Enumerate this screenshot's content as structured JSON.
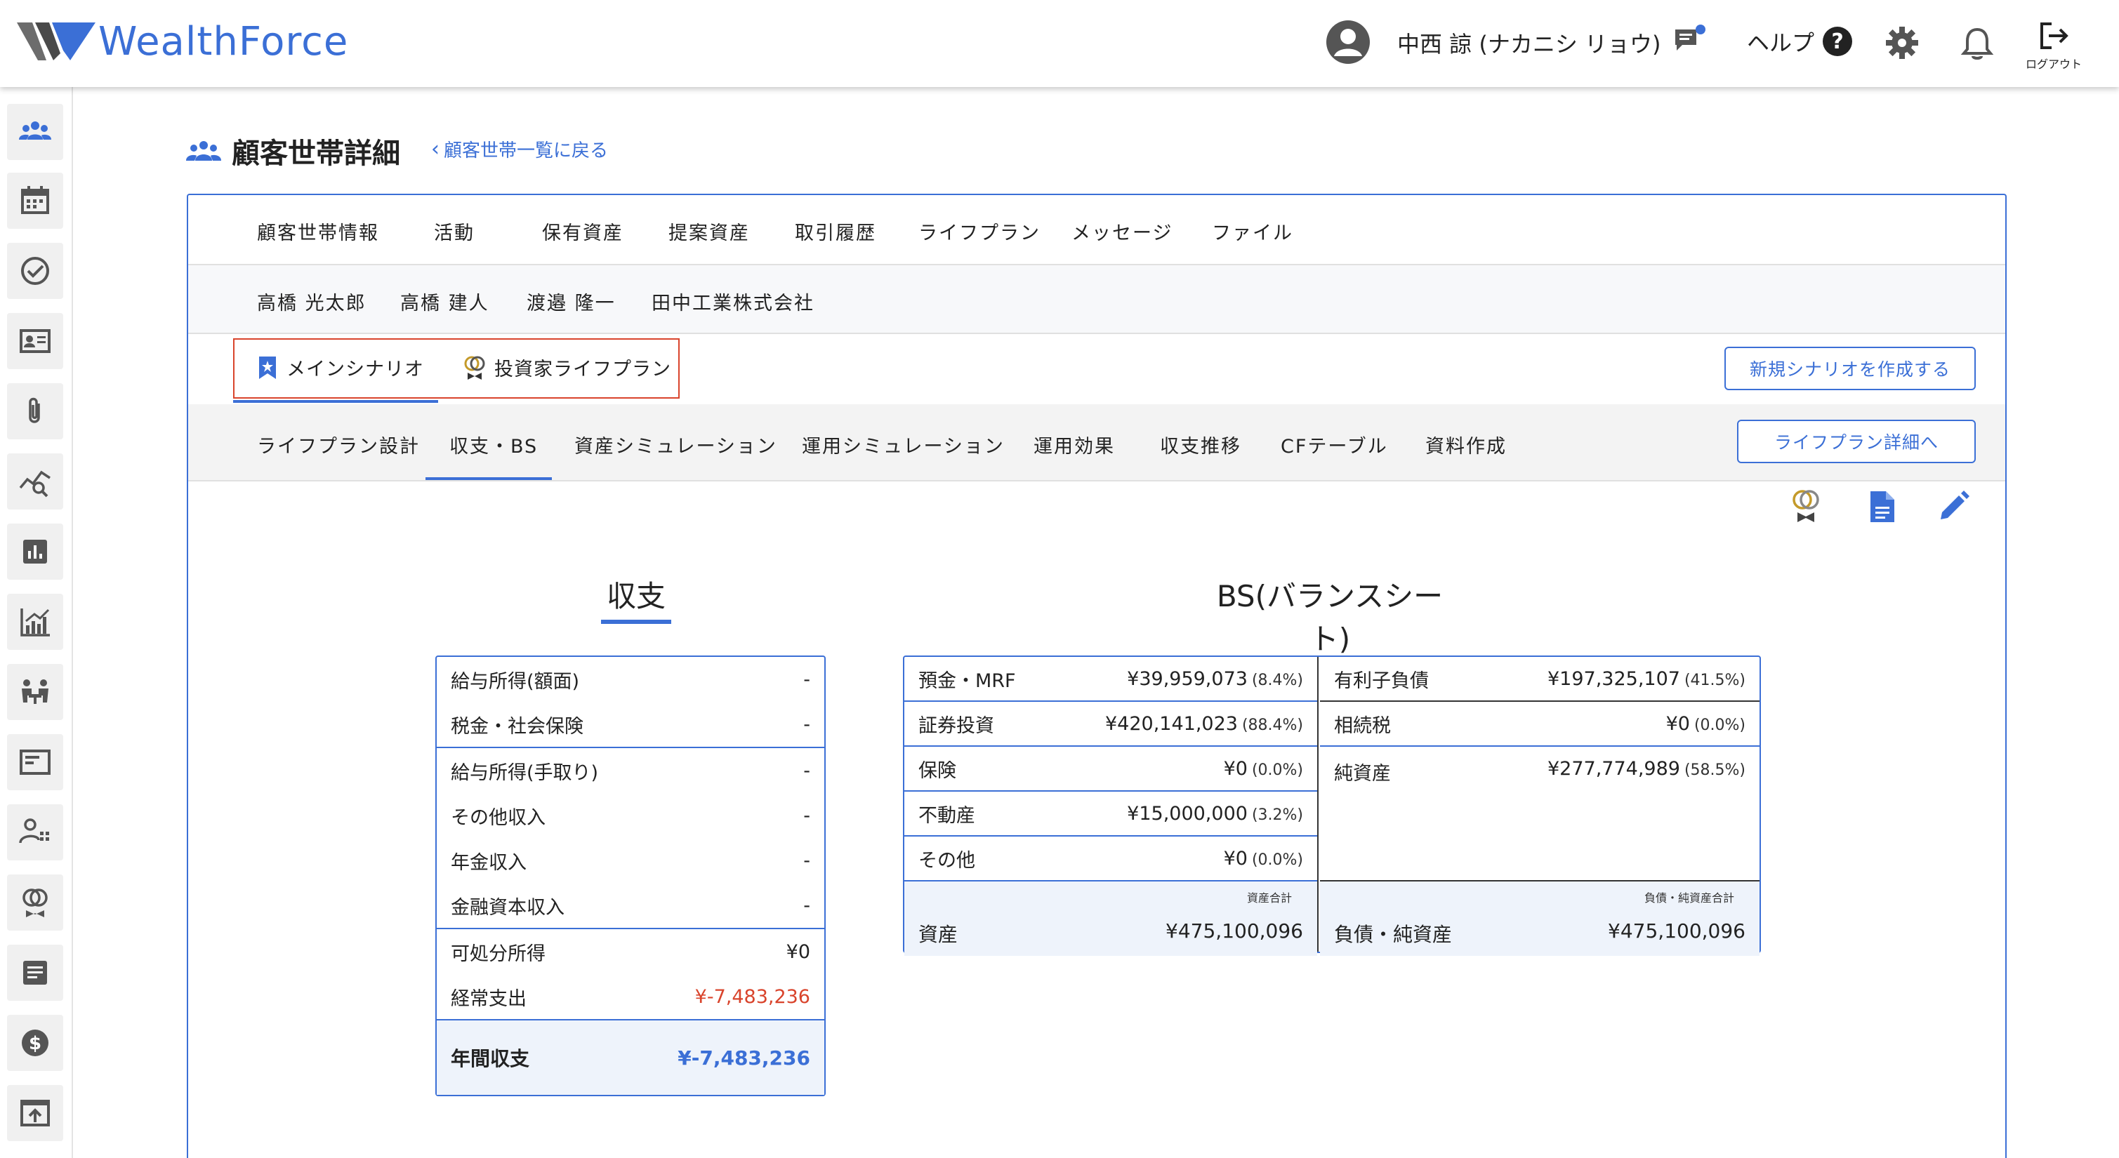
{
  "header": {
    "logo_text": "WealthForce",
    "user_name": "中西 諒 (ナカニシ リョウ)",
    "help_label": "ヘルプ",
    "help_symbol": "?",
    "logout_label": "ログアウト"
  },
  "page": {
    "title": "顧客世帯詳細",
    "back_link": "顧客世帯一覧に戻る",
    "back_chevron": "‹"
  },
  "main_tabs": [
    "顧客世帯情報",
    "活動",
    "保有資産",
    "提案資産",
    "取引履歴",
    "ライフプラン",
    "メッセージ",
    "ファイル"
  ],
  "member_tabs": [
    "高橋 光太郎",
    "高橋 建人",
    "渡邉 隆一",
    "田中工業株式会社"
  ],
  "scenarios": {
    "items": [
      "メインシナリオ",
      "投資家ライフプラン"
    ],
    "new_button": "新規シナリオを作成する"
  },
  "sub_tabs": [
    "ライフプラン設計",
    "収支・BS",
    "資産シミュレーション",
    "運用シミュレーション",
    "運用効果",
    "収支推移",
    "CFテーブル",
    "資料作成"
  ],
  "detail_button": "ライフプラン詳細へ",
  "income": {
    "title": "収支",
    "block1": [
      {
        "label": "給与所得(額面)",
        "value": "-"
      },
      {
        "label": "税金・社会保険",
        "value": "-"
      }
    ],
    "block2": [
      {
        "label": "給与所得(手取り)",
        "value": "-"
      },
      {
        "label": "その他収入",
        "value": "-"
      },
      {
        "label": "年金収入",
        "value": "-"
      },
      {
        "label": "金融資本収入",
        "value": "-"
      }
    ],
    "block3": [
      {
        "label": "可処分所得",
        "value": "¥0"
      },
      {
        "label": "経常支出",
        "value": "¥-7,483,236"
      }
    ],
    "total": {
      "label": "年間収支",
      "value": "¥-7,483,236"
    }
  },
  "bs": {
    "title": "BS(バランスシート)",
    "assets": [
      {
        "label": "預金・MRF",
        "value": "¥39,959,073",
        "pct": "(8.4%)"
      },
      {
        "label": "証券投資",
        "value": "¥420,141,023",
        "pct": "(88.4%)"
      },
      {
        "label": "保険",
        "value": "¥0",
        "pct": "(0.0%)"
      },
      {
        "label": "不動産",
        "value": "¥15,000,000",
        "pct": "(3.2%)"
      },
      {
        "label": "その他",
        "value": "¥0",
        "pct": "(0.0%)"
      }
    ],
    "liabilities": [
      {
        "label": "有利子負債",
        "value": "¥197,325,107",
        "pct": "(41.5%)"
      },
      {
        "label": "相続税",
        "value": "¥0",
        "pct": "(0.0%)"
      },
      {
        "label": "純資産",
        "value": "¥277,774,989",
        "pct": "(58.5%)"
      }
    ],
    "asset_total": {
      "caption": "資産合計",
      "label": "資産",
      "value": "¥475,100,096"
    },
    "liab_total": {
      "caption": "負債・純資産合計",
      "label": "負債・純資産",
      "value": "¥475,100,096"
    }
  },
  "colors": {
    "accent": "#3b6fd6",
    "negative": "#d9442c",
    "highlight_border": "#d9442c"
  }
}
